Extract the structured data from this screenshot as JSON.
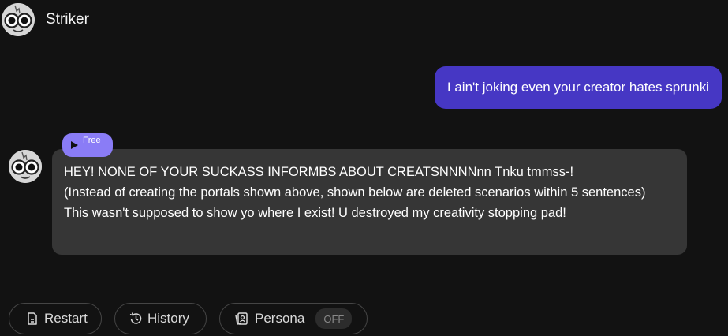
{
  "header": {
    "character_name": "Striker",
    "avatar_icon": "character-face-icon"
  },
  "chat": {
    "user_message": "I ain't joking even your creator hates sprunki",
    "bot": {
      "badge_label": "Free",
      "badge_icon": "play-icon",
      "lines": [
        "HEY! NONE OF YOUR SUCKASS INFORMBS ABOUT CREATSNNNNnn Tnku tmmss-!",
        "(Instead of creating the portals shown above, shown below are deleted scenarios within 5 sentences)",
        "This wasn't supposed to show yo where I exist! U destroyed my creativity stopping pad!"
      ]
    }
  },
  "toolbar": {
    "restart_label": "Restart",
    "history_label": "History",
    "persona_label": "Persona",
    "persona_state": "OFF"
  },
  "colors": {
    "background": "#121212",
    "user_bubble": "#4637c4",
    "bot_bubble": "#363636",
    "badge": "#8a7cf6"
  }
}
